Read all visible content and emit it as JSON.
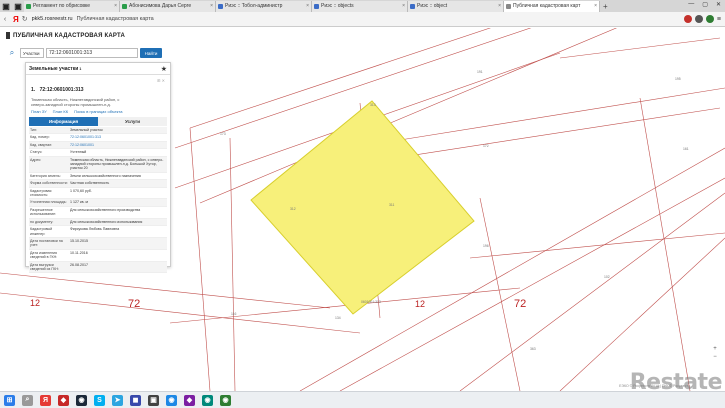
{
  "browser": {
    "tabs": [
      {
        "label": "Регламент по обрисовке",
        "color": "#2a9d4a"
      },
      {
        "label": "Абонисимова Дарья Серге",
        "color": "#2a9d4a"
      },
      {
        "label": "Риэс :: Тобол-администр",
        "color": "#3b6cc7"
      },
      {
        "label": "Риэс :: objects",
        "color": "#3b6cc7"
      },
      {
        "label": "Риэс :: object",
        "color": "#3b6cc7"
      },
      {
        "label": "Публичная кадастровая карт",
        "color": "#888888"
      }
    ],
    "address": {
      "domain": "pkk5.rosreestr.ru",
      "page_title": "Публичная кадастровая карта"
    }
  },
  "app": {
    "title": "ПУБЛИЧНАЯ КАДАСТРОВАЯ КАРТА",
    "search": {
      "type_label": "Участки",
      "query": "72:12:0601001:313",
      "button": "Найти"
    },
    "panel": {
      "header": "Земельные участки",
      "count": "1",
      "item": {
        "index": "1.",
        "number": "72:12:0601001:313",
        "address": "Тюменская область, Нижнетавдинский район, с северо-западной стороны промышлен-н.д.",
        "links": [
          "План ЗУ",
          "План КК",
          "Поиск в границах объекта"
        ]
      },
      "tabs": [
        "Информация",
        "Услуги"
      ],
      "rows": [
        {
          "k": "Тип:",
          "v": "Земельный участок"
        },
        {
          "k": "Кад. номер:",
          "v": "72:12:0601001:313",
          "link": true
        },
        {
          "k": "Кад. квартал:",
          "v": "72:12:0601001",
          "link": true
        },
        {
          "k": "Статус:",
          "v": "Учтенный"
        },
        {
          "k": "Адрес:",
          "v": "Тюменская область, Нижнетавдинский район, с северо-западной стороны промышлен-н.д. Большой Хутор, участок 20"
        },
        {
          "k": "Категория земель:",
          "v": "Земли сельскохозяйственного назначения"
        },
        {
          "k": "Форма собственности:",
          "v": "Частная собственность"
        },
        {
          "k": "Кадастровая стоимость:",
          "v": "1 070,60 руб."
        },
        {
          "k": "Уточненная площадь:",
          "v": "1 127 кв. м"
        },
        {
          "k": "Разрешенное использование:",
          "v": "Для сельскохозяйственного производства"
        },
        {
          "k": "по документу:",
          "v": "Для сельскохозяйственного использования"
        },
        {
          "k": "Кадастровый инженер:",
          "v": "Фирсукова Любовь Павловна"
        },
        {
          "k": "Дата постановки на учет:",
          "v": "15.10.2015"
        },
        {
          "k": "Дата изменения сведений в ГКН:",
          "v": "10.11.2016"
        },
        {
          "k": "Дата выгрузки сведений из ГКН:",
          "v": "26.08.2017"
        }
      ]
    }
  },
  "map": {
    "big_labels": [
      "12",
      "72",
      "12",
      "72"
    ],
    "parcel_labels": [
      "313",
      "312",
      "311",
      "313",
      "196",
      "172",
      "173",
      "191",
      "195",
      "134",
      "116",
      "313",
      "363",
      "161",
      "102"
    ],
    "parcel_number": "0601001:313",
    "parcel_color": "#f7f07a",
    "copyright": "ЕЭКО © Росреестр 2010 | ПКК © Росреестр",
    "watermark": "Restate"
  }
}
